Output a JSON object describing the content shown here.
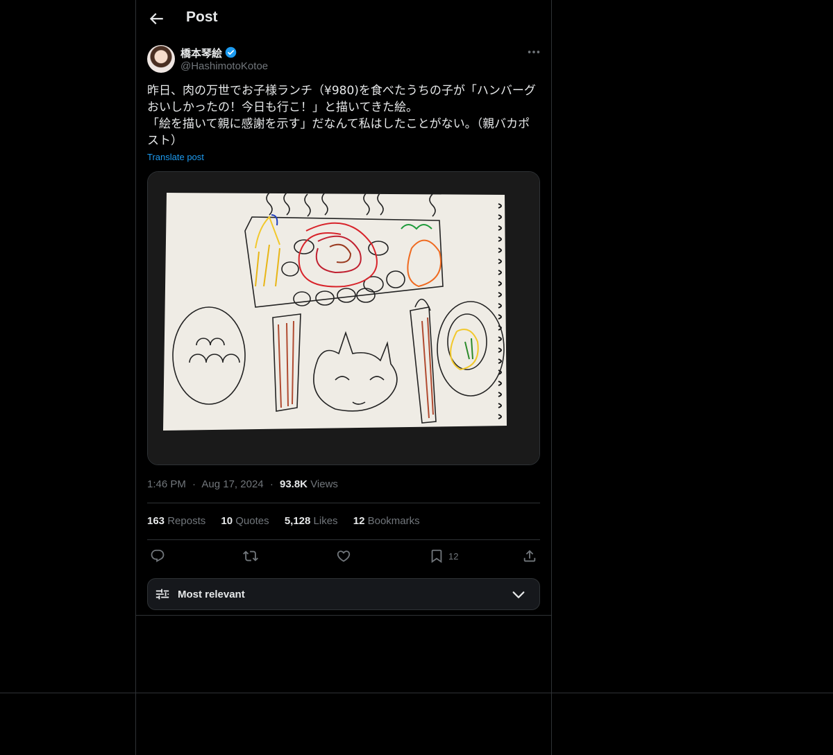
{
  "header": {
    "title": "Post"
  },
  "author": {
    "name": "橋本琴絵",
    "handle": "@HashimotoKotoe"
  },
  "post": {
    "text": "昨日、肉の万世でお子様ランチ（¥980)を食べたうちの子が「ハンバーグおいしかったの！今日も行こ！」と描いてきた絵。\n「絵を描いて親に感謝を示す」だなんて私はしたことがない。（親バカポスト）",
    "translate_label": "Translate post"
  },
  "meta": {
    "time": "1:46 PM",
    "dot": "·",
    "date": "Aug 17, 2024",
    "views_count": "93.8K",
    "views_label": "Views"
  },
  "stats": [
    {
      "count": "163",
      "label": "Reposts"
    },
    {
      "count": "10",
      "label": "Quotes"
    },
    {
      "count": "5,128",
      "label": "Likes"
    },
    {
      "count": "12",
      "label": "Bookmarks"
    }
  ],
  "actions": {
    "bookmark_count": "12"
  },
  "sort": {
    "label": "Most relevant"
  },
  "icons": [
    "back-arrow-icon",
    "verified-badge-icon",
    "more-icon",
    "reply-icon",
    "repost-icon",
    "like-icon",
    "bookmark-icon",
    "share-icon",
    "sliders-icon",
    "chevron-down-icon"
  ],
  "colors": {
    "background": "#000000",
    "text": "#e7e9ea",
    "muted": "#71767b",
    "accent": "#1d9bf0",
    "border": "#2f3336"
  }
}
